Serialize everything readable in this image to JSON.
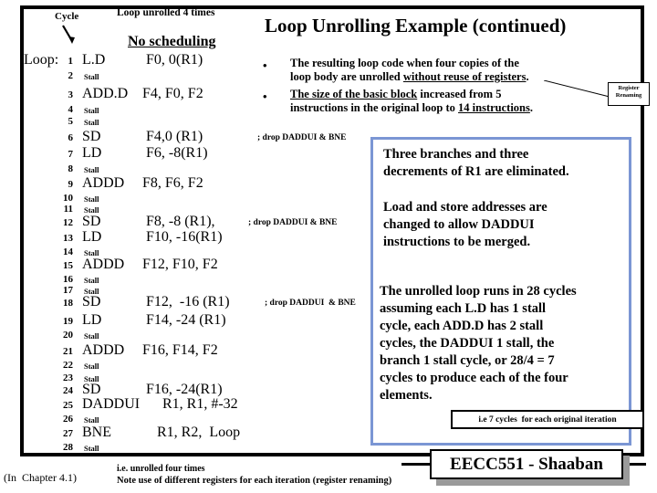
{
  "slide": {
    "title": "Loop Unrolling Example (continued)",
    "cycle_label": "Cycle",
    "unrolled_label": "Loop unrolled 4 times",
    "no_scheduling_label": "No scheduling",
    "loop_label": "Loop:"
  },
  "code": {
    "rows": [
      {
        "cycle": "1",
        "op": "L.D",
        "operands": "F0, 0(R1)",
        "comment": ""
      },
      {
        "cycle": "2",
        "op": "Stall",
        "operands": "",
        "comment": ""
      },
      {
        "cycle": "3",
        "op": "ADD.D",
        "operands": "F4, F0, F2",
        "comment": ""
      },
      {
        "cycle": "4",
        "op": "Stall",
        "operands": "",
        "comment": ""
      },
      {
        "cycle": "5",
        "op": "Stall",
        "operands": "",
        "comment": ""
      },
      {
        "cycle": "6",
        "op": "SD",
        "operands": "F4,0 (R1)",
        "comment": "; drop DADDUI & BNE"
      },
      {
        "cycle": "7",
        "op": "LD",
        "operands": "F6, -8(R1)",
        "comment": ""
      },
      {
        "cycle": "8",
        "op": "Stall",
        "operands": "",
        "comment": ""
      },
      {
        "cycle": "9",
        "op": "ADDD",
        "operands": "F8, F6, F2",
        "comment": ""
      },
      {
        "cycle": "10",
        "op": "Stall",
        "operands": "",
        "comment": ""
      },
      {
        "cycle": "11",
        "op": "Stall",
        "operands": "",
        "comment": ""
      },
      {
        "cycle": "12",
        "op": "SD",
        "operands": "F8, -8 (R1),",
        "comment": "; drop DADDUI & BNE"
      },
      {
        "cycle": "13",
        "op": "LD",
        "operands": "F10, -16(R1)",
        "comment": ""
      },
      {
        "cycle": "14",
        "op": "Stall",
        "operands": "",
        "comment": ""
      },
      {
        "cycle": "15",
        "op": "ADDD",
        "operands": "F12, F10, F2",
        "comment": ""
      },
      {
        "cycle": "16",
        "op": "Stall",
        "operands": "",
        "comment": ""
      },
      {
        "cycle": "17",
        "op": "Stall",
        "operands": "",
        "comment": ""
      },
      {
        "cycle": "18",
        "op": "SD",
        "operands": "F12,  -16 (R1)",
        "comment": "; drop DADDUI  & BNE"
      },
      {
        "cycle": "19",
        "op": "LD",
        "operands": "F14, -24 (R1)",
        "comment": ""
      },
      {
        "cycle": "20",
        "op": "Stall",
        "operands": "",
        "comment": ""
      },
      {
        "cycle": "21",
        "op": "ADDD",
        "operands": "F16, F14, F2",
        "comment": ""
      },
      {
        "cycle": "22",
        "op": "Stall",
        "operands": "",
        "comment": ""
      },
      {
        "cycle": "23",
        "op": "Stall",
        "operands": "",
        "comment": ""
      },
      {
        "cycle": "24",
        "op": "SD",
        "operands": "F16, -24(R1)",
        "comment": ""
      },
      {
        "cycle": "25",
        "op": "DADDUI",
        "operands": "R1, R1, #-32",
        "comment": ""
      },
      {
        "cycle": "26",
        "op": "Stall",
        "operands": "",
        "comment": ""
      },
      {
        "cycle": "27",
        "op": "BNE",
        "operands": "R1, R2,  Loop",
        "comment": ""
      },
      {
        "cycle": "28",
        "op": "Stall",
        "operands": "",
        "comment": ""
      }
    ]
  },
  "bullets": [
    {
      "marker": "•",
      "line1_pre": "The resulting loop code when four copies of the",
      "line2_pre": "loop body are unrolled ",
      "line2_underline": "without reuse of registers",
      "line2_post": "."
    },
    {
      "marker": "•",
      "line1_underline": "The size of the basic block",
      "line1_post": " increased from  5",
      "line2_pre": "instructions in the original loop to ",
      "line2_underline": "14 instructions",
      "line2_post": "."
    }
  ],
  "callout": {
    "line1": "Register",
    "line2": "Renaming"
  },
  "notes": {
    "note1": "Three branches and three\ndecrements of R1 are eliminated.",
    "note2": "Load and store addresses are\nchanged to allow DADDUI\ninstructions to be merged.",
    "note3": "The unrolled loop runs in 28 cycles\nassuming  each L.D has  1 stall\ncycle,  each ADD.D  has 2 stall\ncycles, the DADDUI  1 stall,  the\nbranch 1 stall cycle,  or 28/4 = 7\ncycles to produce each of the four\nelements.",
    "ie_box": "i.e 7 cycles  for each original iteration"
  },
  "footer": {
    "course": "EECC551 - Shaaban",
    "chapter_note": "(In  Chapter 4.1)",
    "ie_unrolled": "i.e. unrolled four times",
    "reg_renaming_note": "Note use of different registers for each iteration (register renaming)"
  },
  "colors": {
    "frame": "#000000",
    "blue_box_border": "#7b96d4",
    "shadow": "#9a9a9a",
    "text": "#000000",
    "background": "#ffffff"
  }
}
